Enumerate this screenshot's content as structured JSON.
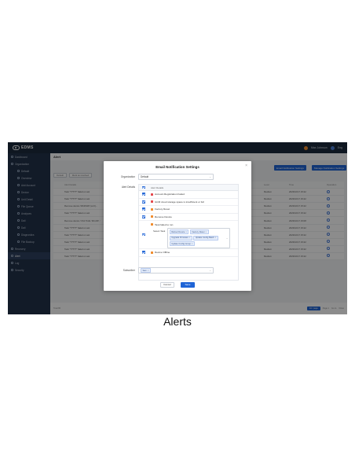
{
  "app": {
    "logo_text": "EDMS",
    "user_label": "Max Johnson",
    "lang_label": "Eng"
  },
  "sidebar": {
    "items": [
      {
        "label": "Dashboard",
        "sub": false
      },
      {
        "label": "Organization",
        "sub": false
      },
      {
        "label": "Default",
        "sub": true
      },
      {
        "label": "Overview",
        "sub": true
      },
      {
        "label": "Add Account",
        "sub": true
      },
      {
        "label": "Device",
        "sub": true
      },
      {
        "label": "Unit Detail",
        "sub": true
      },
      {
        "label": "File Queue",
        "sub": true
      },
      {
        "label": "Analyses",
        "sub": true
      },
      {
        "label": "Dali",
        "sub": true
      },
      {
        "label": "Dali",
        "sub": true
      },
      {
        "label": "Diagnostics",
        "sub": true
      },
      {
        "label": "File Backup",
        "sub": true
      },
      {
        "label": "Recovery",
        "sub": false
      },
      {
        "label": "Alert",
        "sub": false,
        "active": true
      },
      {
        "label": "Log",
        "sub": false
      },
      {
        "label": "Security",
        "sub": false
      }
    ]
  },
  "page": {
    "title": "Alert",
    "btn_email": "Email Notification Settings",
    "btn_manage": "Manage Notification Settings",
    "toolbar": [
      "Default",
      "Mark as resolved"
    ],
    "columns": [
      "Alert Details",
      "Level",
      "Time",
      "Operation"
    ],
    "rows": [
      {
        "detail": "Task \"?????\" failed on ast",
        "level": "Medium",
        "time": "2023/10/17 15:22"
      },
      {
        "detail": "Task \"?????\" failed on ast",
        "level": "Medium",
        "time": "2023/10/17 15:22"
      },
      {
        "detail": "Remove device 'MCDS45' (at 0(...",
        "level": "Medium",
        "time": "2023/10/17 15:22"
      },
      {
        "detail": "Task \"?????\" failed on ast",
        "level": "Medium",
        "time": "2023/10/17 15:22"
      },
      {
        "detail": "Remove device 'CS1' Pulls 'RC-RP...'",
        "level": "Medium",
        "time": "2023/10/17 15:08"
      },
      {
        "detail": "Task \"?????\" failed on ast",
        "level": "Medium",
        "time": "2023/10/17 15:22"
      },
      {
        "detail": "Task \"?????\" failed on ast",
        "level": "Medium",
        "time": "2023/10/17 15:22"
      },
      {
        "detail": "Task \"?????\" failed on ast",
        "level": "Medium",
        "time": "2023/10/17 15:22"
      },
      {
        "detail": "Task \"?????\" failed on ast",
        "level": "Medium",
        "time": "2023/10/17 15:22"
      },
      {
        "detail": "Task \"?????\" failed on ast",
        "level": "Medium",
        "time": "2023/10/17 15:22"
      }
    ],
    "footer_total": "Total 86",
    "footer_page_btn": "10 / page",
    "footer_page_label": "Page 1",
    "footer_goto": "Go to",
    "footer_close": "Close"
  },
  "modal": {
    "title": "Email Notification Settings",
    "org_label": "Organization",
    "org_value": "Default",
    "alert_details_label": "Alert Details",
    "table_header": "Alert Details",
    "alerts": [
      {
        "label": "Account Registration Failed",
        "color": "#e5484d",
        "checked": true
      },
      {
        "label": "GCM cloud storage space is insufficient or full",
        "color": "#e5484d",
        "checked": true
      },
      {
        "label": "Factory Reset",
        "color": "#f08c2e",
        "checked": true
      },
      {
        "label": "Remove Device",
        "color": "#f08c2e",
        "checked": true
      },
      {
        "label": "Task failed to run",
        "color": "#f08c2e",
        "checked": true
      },
      {
        "label": "Device Offline",
        "color": "#f08c2e",
        "checked": true
      }
    ],
    "select_task_label": "Select Task",
    "task_tags": [
      "Reboot Device",
      "Factory Reset",
      "Upgrade Firmware",
      "Update Config Batch",
      "Update Config Group"
    ],
    "subscriber_label": "Subscriber",
    "subscriber_tag": "Sam",
    "cancel_label": "Cancel",
    "save_label": "Save"
  },
  "caption": "Alerts"
}
